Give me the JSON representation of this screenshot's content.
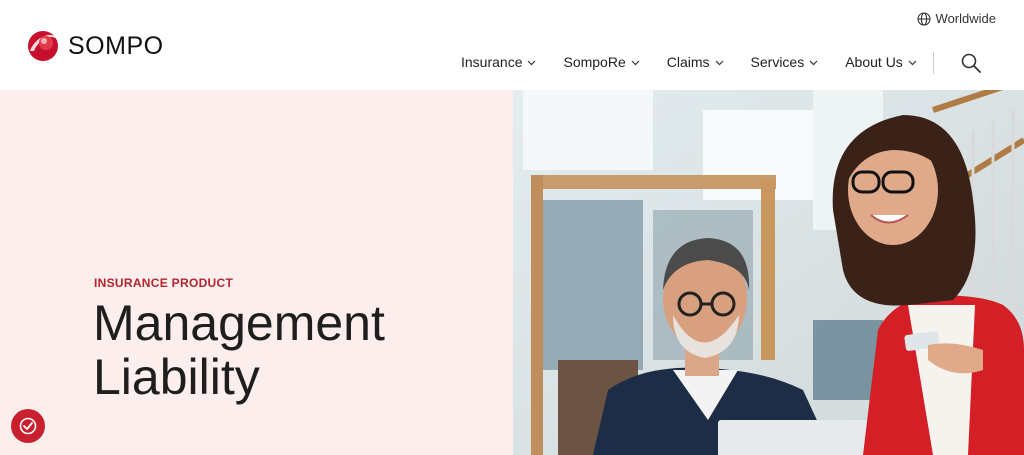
{
  "brand": {
    "name": "SOMPO",
    "color": "#c8102e"
  },
  "utility": {
    "worldwide_label": "Worldwide",
    "icon": "globe-icon"
  },
  "nav": {
    "items": [
      {
        "label": "Insurance"
      },
      {
        "label": "SompoRe"
      },
      {
        "label": "Claims"
      },
      {
        "label": "Services"
      },
      {
        "label": "About Us"
      }
    ],
    "search_icon": "search-icon"
  },
  "hero": {
    "eyebrow": "INSURANCE PRODUCT",
    "title_line1": "Management",
    "title_line2": "Liability",
    "background": "#fdeeee",
    "accent": "#b1252e"
  },
  "cookie": {
    "icon": "cookie-settings-icon",
    "color": "#c8202f"
  }
}
